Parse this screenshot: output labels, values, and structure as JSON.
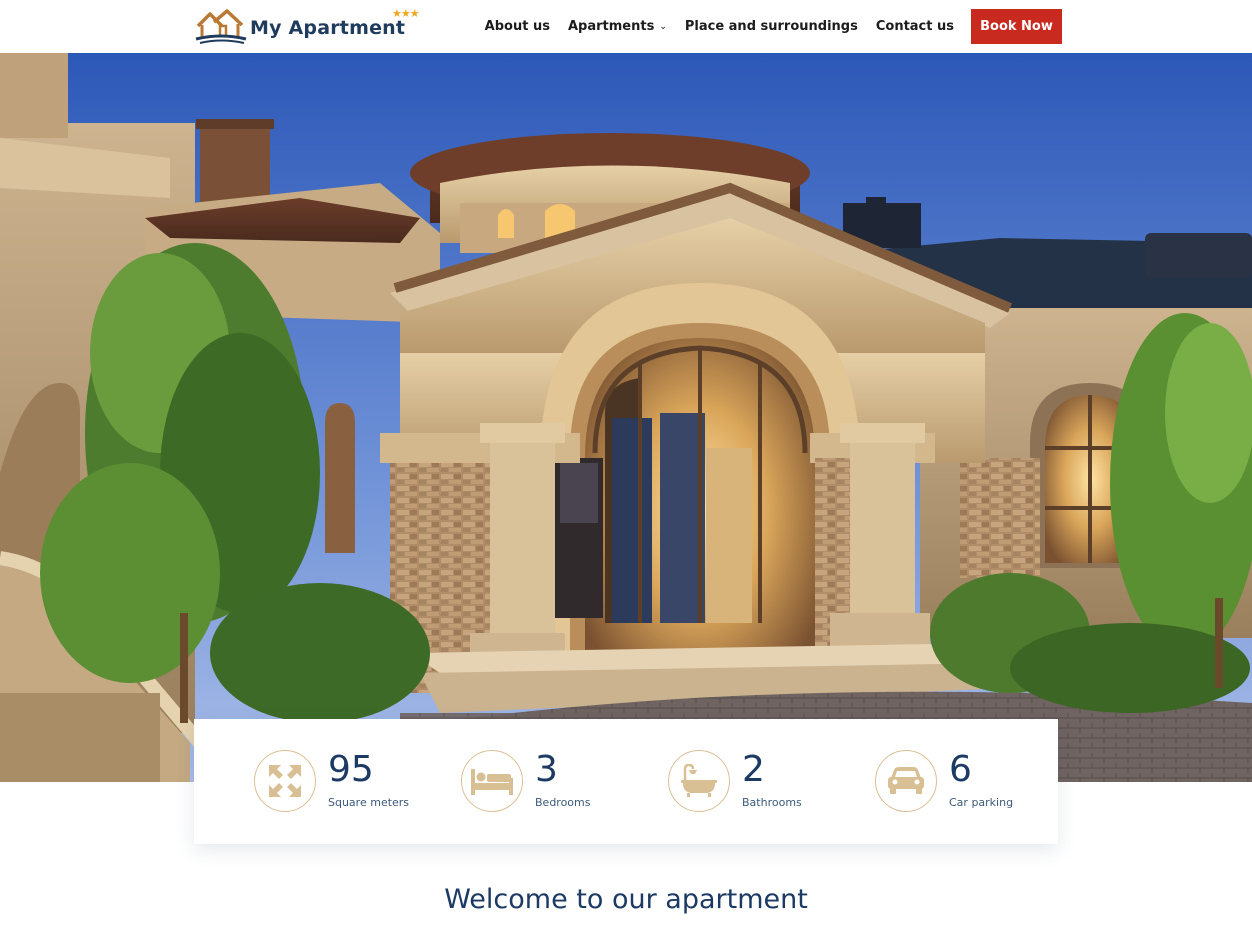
{
  "header": {
    "logo_text": "My Apartment",
    "logo_stars": "★★★",
    "nav": [
      {
        "label": "About us"
      },
      {
        "label": "Apartments",
        "has_dropdown": true
      },
      {
        "label": "Place and surroundings"
      },
      {
        "label": "Contact us"
      }
    ],
    "cta_label": "Book Now"
  },
  "stats": [
    {
      "value": "95",
      "label": "Square meters",
      "icon": "expand-arrows-icon"
    },
    {
      "value": "3",
      "label": "Bedrooms",
      "icon": "bed-icon"
    },
    {
      "value": "2",
      "label": "Bathrooms",
      "icon": "bathtub-icon"
    },
    {
      "value": "6",
      "label": "Car parking",
      "icon": "car-icon"
    }
  ],
  "welcome_heading": "Welcome to our apartment",
  "colors": {
    "brand_navy": "#1c3a63",
    "cta_red": "#c82a20",
    "icon_gold": "#d9bf94",
    "star_gold": "#f0a51d"
  }
}
